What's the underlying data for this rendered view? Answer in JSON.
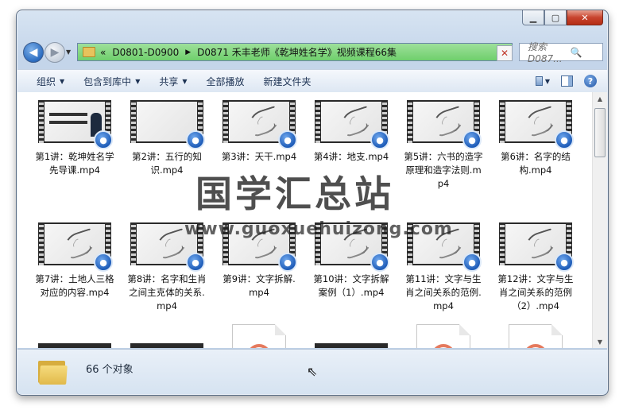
{
  "window": {
    "minimize": "▁",
    "maximize": "▢",
    "close": "✕"
  },
  "nav": {
    "back_icon": "arrow-left",
    "forward_icon": "arrow-right"
  },
  "address": {
    "prefix": "«",
    "segments": [
      "D0801-D0900",
      "D0871 禾丰老师《乾坤姓名学》视频课程66集"
    ],
    "separator": "▶",
    "dropdown": "▼",
    "clear": "✕"
  },
  "search": {
    "placeholder": "搜索 D087...",
    "icon": "🔍"
  },
  "toolbar": {
    "items": [
      "组织",
      "包含到库中",
      "共享",
      "全部播放",
      "新建文件夹"
    ],
    "help": "?"
  },
  "files": [
    {
      "label": "第1讲：乾坤姓名学先导课.mp4",
      "thumb": "text"
    },
    {
      "label": "第2讲：五行的知识.mp4",
      "thumb": "dark"
    },
    {
      "label": "第3讲：天干.mp4",
      "thumb": "ink"
    },
    {
      "label": "第4讲：地支.mp4",
      "thumb": "ink"
    },
    {
      "label": "第5讲：六书的造字原理和造字法则.mp4",
      "thumb": "ink"
    },
    {
      "label": "第6讲：名字的结构.mp4",
      "thumb": "ink"
    },
    {
      "label": "第7讲：土地人三格对应的内容.mp4",
      "thumb": "ink"
    },
    {
      "label": "第8讲：名字和生肖之间主克体的关系.mp4",
      "thumb": "ink"
    },
    {
      "label": "第9讲：文字拆解.mp4",
      "thumb": "ink"
    },
    {
      "label": "第10讲：文字拆解案例（1）.mp4",
      "thumb": "ink"
    },
    {
      "label": "第11讲：文字与生肖之间关系的范例.mp4",
      "thumb": "ink"
    },
    {
      "label": "第12讲：文字与生肖之间关系的范例（2）.mp4",
      "thumb": "ink"
    }
  ],
  "status": {
    "count": "66 个对象"
  },
  "watermark": {
    "title": "国学汇总站",
    "url": "www.guoxuehuizong.com"
  },
  "colors": {
    "address_bar": "#6fcf6c",
    "badge": "#1e5cb8",
    "doc_icon": "#e57a5e"
  }
}
